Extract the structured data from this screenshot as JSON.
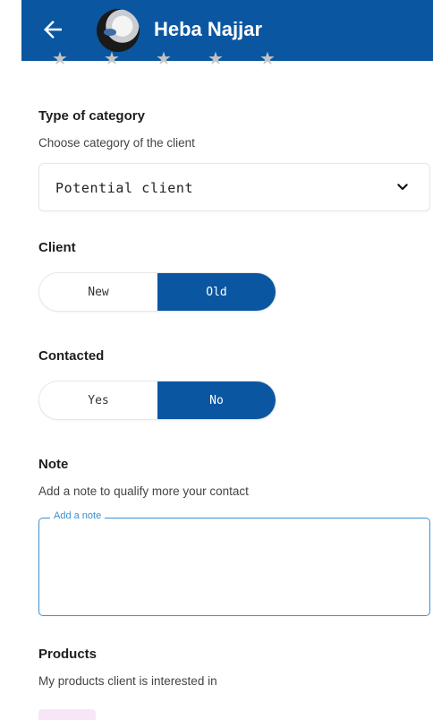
{
  "header": {
    "title": "Heba Najjar",
    "accent_color": "#0b56a1"
  },
  "rating": {
    "max": 5,
    "value": 0
  },
  "category": {
    "title": "Type of category",
    "subtitle": "Choose category of the client",
    "selected": "Potential client"
  },
  "client": {
    "title": "Client",
    "options": [
      "New",
      "Old"
    ],
    "selected": "Old"
  },
  "contacted": {
    "title": "Contacted",
    "options": [
      "Yes",
      "No"
    ],
    "selected": "No"
  },
  "note": {
    "title": "Note",
    "subtitle": "Add a note to qualify more your contact",
    "label": "Add a note",
    "value": ""
  },
  "products": {
    "title": "Products",
    "subtitle": "My products client is interested in"
  }
}
